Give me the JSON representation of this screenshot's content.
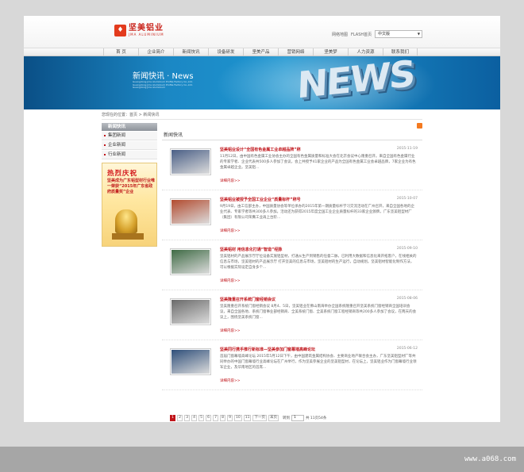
{
  "header": {
    "logo_cn": "坚美铝业",
    "logo_en": "JMA ALUMINIUM",
    "links": [
      "网络地图",
      "FLASH首页"
    ],
    "language_selected": "中文版"
  },
  "nav": [
    "首 页",
    "企业简介",
    "新闻快讯",
    "设备研发",
    "坚美产品",
    "营销网络",
    "坚美梦",
    "人力资源",
    "联系我们"
  ],
  "banner": {
    "title": "新闻快讯 · News",
    "subtitle": "Guangdong Jma Aluminium Profile Factory Co.,Ltd. Guangdong Jma Aluminium Profile Factory Co.,Ltd. Guangdong Jma Aluminium",
    "big_word": "NEWS"
  },
  "breadcrumb": "您现在的位置：首页 > 新闻快讯",
  "sidebar": {
    "head": "新闻快讯",
    "items": [
      "集团新闻",
      "企业新闻",
      "行业新闻"
    ],
    "promo_title": "热烈庆祝",
    "promo_text": "坚美成为广东铝型材行业唯一荣获“2015年广东省政府质量奖”企业"
  },
  "content": {
    "head": "新闻快讯",
    "more_label": "详细内容>>",
    "articles": [
      {
        "title": "坚美铝业设计“全国有色金属工业卓越品牌”称",
        "date": "2015-11-19",
        "body": "11月12日，由中国有色金属工业协会主办的全国有色金属质量和标准大会在北京会议中心隆重召开。来自全国有色金属行业的专家学者、企业代表共500多人参加了会议，会上共授予41家企业的产品为全国有色金属工业会卓越品牌，7家企业为有色金属卓越企业。坚美铝...",
        "thumb_color": "#4a5f86"
      },
      {
        "title": "坚美铝业被授予全国工业企业“质量标杆”称号",
        "date": "2015-10-07",
        "body": "9月19日，由工信部主办，中国质量协会等单位承办的2015年第一期质量标杆学习交流活动在广州召开，来自全国各地的企业代表、专家学者等共300多人参加。活动还为获得2015年度全国工业企业质量标杆的33家企业颁牌，广东坚美铝型材厂（集团）有限公司荣膺工业再上台阶...",
        "thumb_color": "#b24b2f"
      },
      {
        "title": "坚美铝材 用信息化打通“智造”经脉",
        "date": "2015-09-10",
        "body": "坚美铝材的产品展示厅厅位设备实施铝型材，打通从生产到销售的任督二脉，已利用大数据和信息化来开拓客户，在线相关的信息与市场，坚美铝材的产品展示厅 打开坚美的信息与市场，坚美铝材的生产运行，自动规划。坚美铝材智能化制作方法，可以根据实际设定自身多个...",
        "thumb_color": "#3f6b45"
      },
      {
        "title": "坚美隆重召开系统门窗经销会议",
        "date": "2015-08-06",
        "body": "坚美隆重召开系统门窗经销会议 8月4、5日，坚美铝业在佛山南海举办全国系统隆重召开坚美系统门窗经销商全国培训会议，来自全国各地、系统门窗事业部经销商、全美系统门窗、全美系统门窗工程经销商等共200多人参加了会议，在两天的会议上，围绕坚美系统门窗...",
        "thumb_color": "#6a6a6a"
      },
      {
        "title": "坚美同行携手推行新标准—坚美参加门窗幕墙高峰论坛",
        "date": "2015-06-12",
        "body": "首届门窗幕墙高峰论坛 2015年5月12日下午，由中国建筑金属结构协会、主要商业地产联合会主办，广东坚美铝型材厂等共同举办的中国门窗幕墙行业高峰论坛在广州举行，作为坚美参展企业的坚美铝型材，在论坛上，坚美铝业作为门窗幕墙行业领军企业，及华南地区的首席...",
        "thumb_color": "#2f4f7a"
      }
    ]
  },
  "pager": {
    "pages": [
      "1",
      "2",
      "3",
      "4",
      "5",
      "6",
      "7",
      "8",
      "9",
      "10",
      "11",
      "下一页",
      "末页"
    ],
    "current": "1",
    "go_label": "转到",
    "select_value": "1",
    "total_label": "共 11页54条"
  },
  "watermark": "www.a068.com",
  "colors": {
    "accent": "#c0141a",
    "banner": "#1d95d0",
    "rss": "#f47a20"
  }
}
